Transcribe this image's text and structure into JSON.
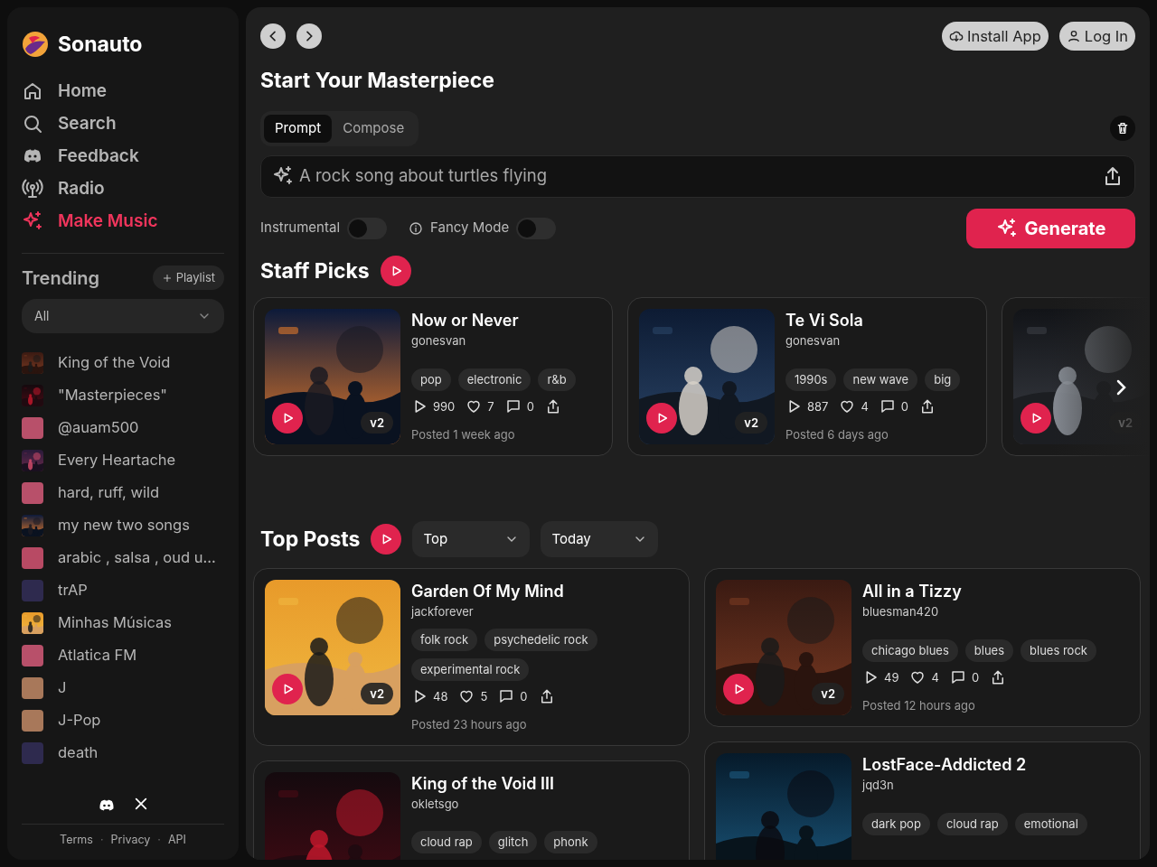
{
  "sidebar": {
    "brand": "Sonauto",
    "nav": [
      {
        "label": "Home",
        "kind": "home",
        "selected": false
      },
      {
        "label": "Search",
        "kind": "search",
        "selected": false
      },
      {
        "label": "Feedback",
        "kind": "discord",
        "selected": false
      },
      {
        "label": "Radio",
        "kind": "radio",
        "selected": false
      },
      {
        "label": "Make Music",
        "kind": "sparkle",
        "selected": true
      }
    ],
    "trending": {
      "title": "Trending",
      "playlist_button": "Playlist",
      "filter": "All",
      "items": [
        {
          "title": "King of the Void",
          "kind": "picture"
        },
        {
          "title": "\"Masterpieces\"",
          "kind": "picture"
        },
        {
          "title": "@auam500",
          "kind": "swatch",
          "color": "#b8506a"
        },
        {
          "title": "Every Heartache",
          "kind": "picture"
        },
        {
          "title": "hard, ruff, wild",
          "kind": "swatch",
          "color": "#b8506a"
        },
        {
          "title": "my new two songs",
          "kind": "picture"
        },
        {
          "title": "arabic , salsa , oud u...",
          "kind": "swatch",
          "color": "#b84a64"
        },
        {
          "title": "trAP",
          "kind": "swatch",
          "color": "#2e2a4e"
        },
        {
          "title": "Minhas Músicas",
          "kind": "picture"
        },
        {
          "title": "Atlatica FM",
          "kind": "swatch",
          "color": "#b8506a"
        },
        {
          "title": "J",
          "kind": "swatch",
          "color": "#a8785a"
        },
        {
          "title": "J-Pop",
          "kind": "swatch",
          "color": "#a8785a"
        },
        {
          "title": "death",
          "kind": "swatch",
          "color": "#2e2a4e"
        }
      ]
    },
    "footer_links": [
      "Terms",
      "Privacy",
      "API"
    ],
    "footer_separator": "·"
  },
  "header": {
    "buttons": [
      "Install App",
      "Log In"
    ]
  },
  "composer": {
    "title": "Start Your Masterpiece",
    "tabs": [
      {
        "label": "Prompt",
        "selected": true
      },
      {
        "label": "Compose",
        "selected": false
      }
    ],
    "prompt": {
      "placeholder": "A rock song about turtles flying"
    },
    "toggles": [
      {
        "label": "Instrumental",
        "on": false,
        "info": false
      },
      {
        "label": "Fancy Mode",
        "on": false,
        "info": true
      }
    ],
    "generate_button": "Generate"
  },
  "staff_picks": {
    "title": "Staff Picks",
    "cards": [
      {
        "title": "Now or Never",
        "author": "gonesvan",
        "tags": [
          "pop",
          "electronic",
          "r&b"
        ],
        "plays": "990",
        "likes": "7",
        "comments": "0",
        "posted": "Posted 1 week ago",
        "version": "v2"
      },
      {
        "title": "Te Vi Sola",
        "author": "gonesvan",
        "tags": [
          "1990s",
          "new wave",
          "big"
        ],
        "plays": "887",
        "likes": "4",
        "comments": "0",
        "posted": "Posted 6 days ago",
        "version": "v2"
      },
      {
        "version": "v2"
      }
    ]
  },
  "top_posts": {
    "title": "Top Posts",
    "sort": "Top",
    "period": "Today",
    "columns": [
      [
        {
          "title": "Garden Of My Mind",
          "author": "jackforever",
          "tags": [
            "folk rock",
            "psychedelic rock",
            "experimental rock"
          ],
          "plays": "48",
          "likes": "5",
          "comments": "0",
          "posted": "Posted 23 hours ago",
          "version": "v2"
        },
        {
          "title": "King of the Void III",
          "author": "okletsgo",
          "tags": [
            "cloud rap",
            "glitch",
            "phonk"
          ]
        }
      ],
      [
        {
          "title": "All in a Tizzy",
          "author": "bluesman420",
          "tags": [
            "chicago blues",
            "blues",
            "blues rock"
          ],
          "plays": "49",
          "likes": "4",
          "comments": "0",
          "posted": "Posted 12 hours ago",
          "version": "v2"
        },
        {
          "title": "LostFace-Addicted 2",
          "author": "jqd3n",
          "tags": [
            "dark pop",
            "cloud rap",
            "emotional"
          ]
        }
      ]
    ]
  }
}
